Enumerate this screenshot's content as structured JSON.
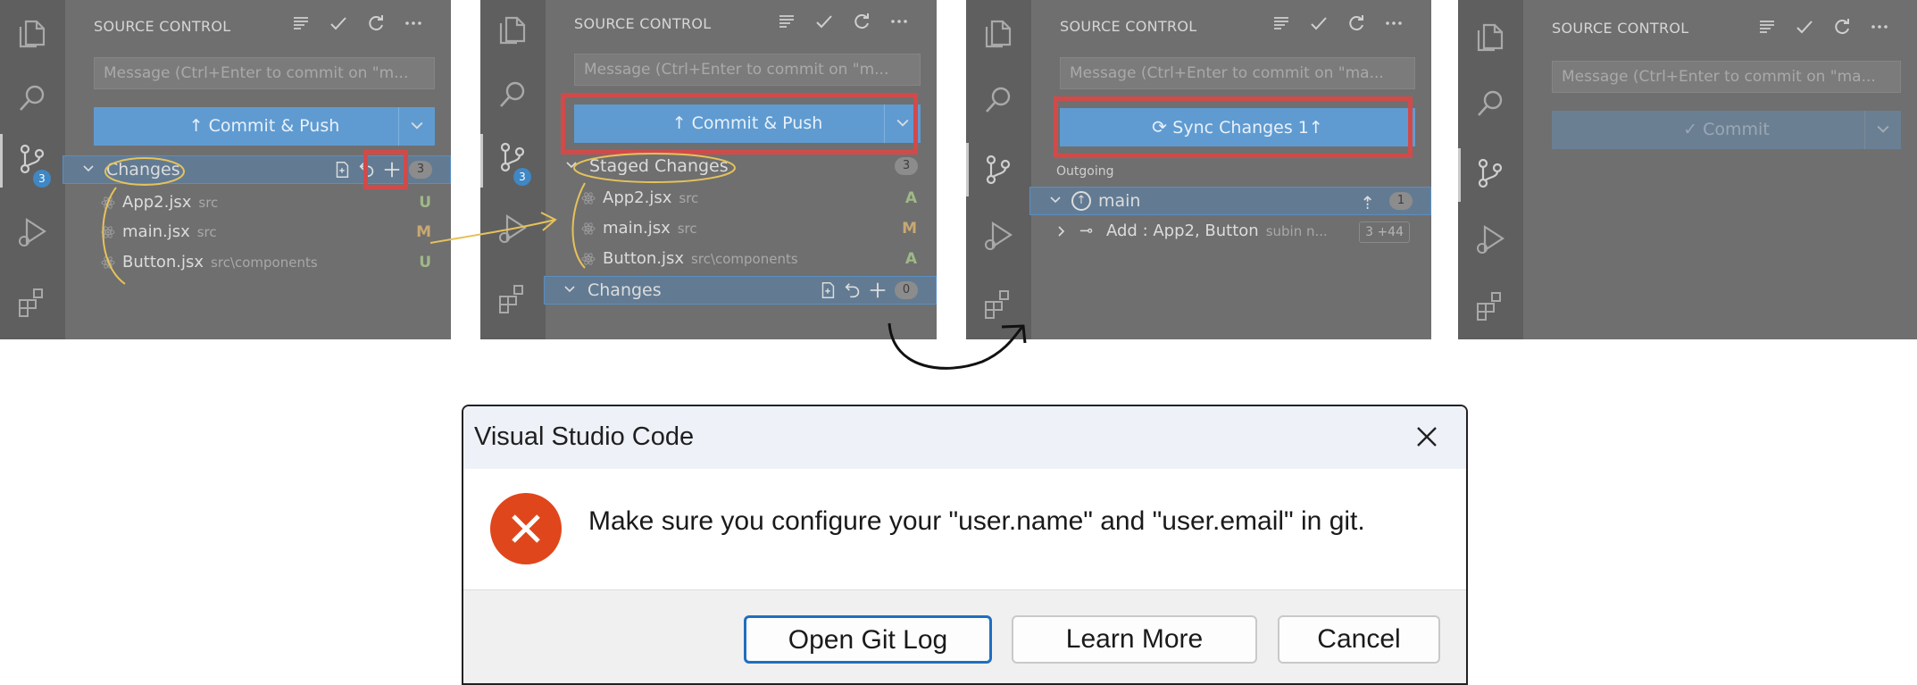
{
  "source_control_title": "SOURCE CONTROL",
  "message_placeholder": "Message (Ctrl+Enter to commit on \"m...",
  "message_placeholder_alt": "Message (Ctrl+Enter to commit on \"ma...",
  "activity_badge": "3",
  "panels": [
    {
      "primary_button": "↑ Commit & Push",
      "group": {
        "label": "Changes",
        "count": "3"
      },
      "files": [
        {
          "name": "App2.jsx",
          "path": "src",
          "status": "U"
        },
        {
          "name": "main.jsx",
          "path": "src",
          "status": "M"
        },
        {
          "name": "Button.jsx",
          "path": "src\\components",
          "status": "U"
        }
      ]
    },
    {
      "primary_button": "↑ Commit & Push",
      "staged_group": {
        "label": "Staged Changes",
        "count": "3"
      },
      "files": [
        {
          "name": "App2.jsx",
          "path": "src",
          "status": "A"
        },
        {
          "name": "main.jsx",
          "path": "src",
          "status": "M"
        },
        {
          "name": "Button.jsx",
          "path": "src\\components",
          "status": "A"
        }
      ],
      "changes_group": {
        "label": "Changes",
        "count": "0"
      }
    },
    {
      "primary_button": "Sync Changes 1↑",
      "outgoing_label": "Outgoing",
      "branch": {
        "label": "main",
        "count": "1"
      },
      "commit": {
        "message": "Add : App2, Button",
        "author": "subin n...",
        "stats": "3 +44"
      }
    },
    {
      "primary_button": "✓ Commit"
    }
  ],
  "dialog": {
    "title": "Visual Studio Code",
    "message": "Make sure you configure your \"user.name\" and \"user.email\" in git.",
    "buttons": [
      "Open Git Log",
      "Learn More",
      "Cancel"
    ]
  },
  "colors": {
    "highlight": "#d14a4a",
    "annotation_yellow": "#e6c25a",
    "primary_blue": "#5f9bd1",
    "error_orange": "#e0461b"
  }
}
